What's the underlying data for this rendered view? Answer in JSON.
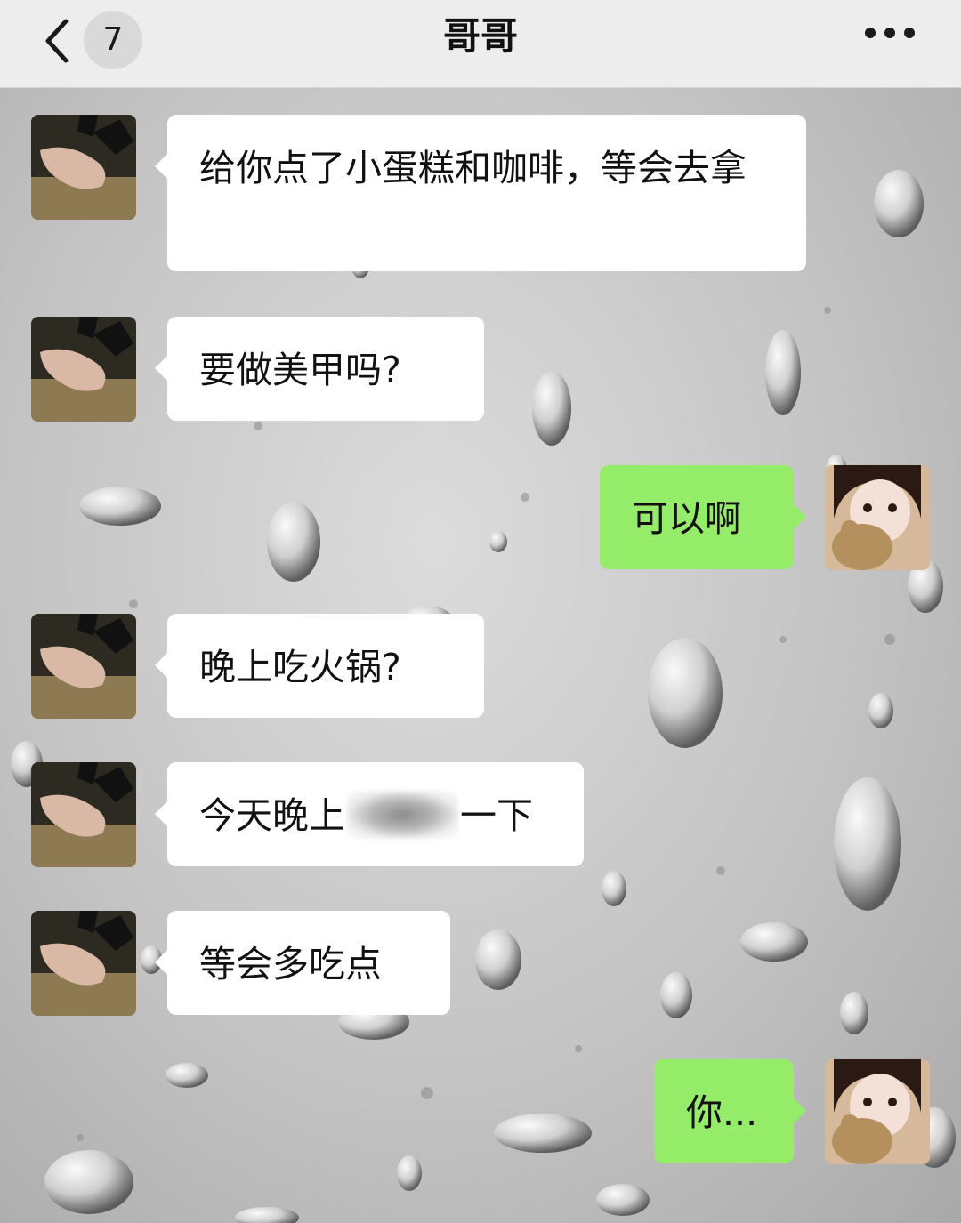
{
  "header": {
    "title": "哥哥",
    "unread_count": "7",
    "back_icon": "chevron-left-icon",
    "more_icon": "more-dots-icon"
  },
  "colors": {
    "header_bg": "#ededed",
    "incoming_bubble": "#ffffff",
    "outgoing_bubble": "#95ec69"
  },
  "messages": [
    {
      "sender": "contact",
      "text": "给你点了小蛋糕和咖啡，等会去拿"
    },
    {
      "sender": "contact",
      "text": "要做美甲吗?"
    },
    {
      "sender": "me",
      "text": "可以啊"
    },
    {
      "sender": "contact",
      "text": "晚上吃火锅?"
    },
    {
      "sender": "contact",
      "text_before": "今天晚上",
      "text_after": "一下",
      "redacted": true
    },
    {
      "sender": "contact",
      "text": "等会多吃点"
    },
    {
      "sender": "me",
      "text": "你..."
    }
  ]
}
